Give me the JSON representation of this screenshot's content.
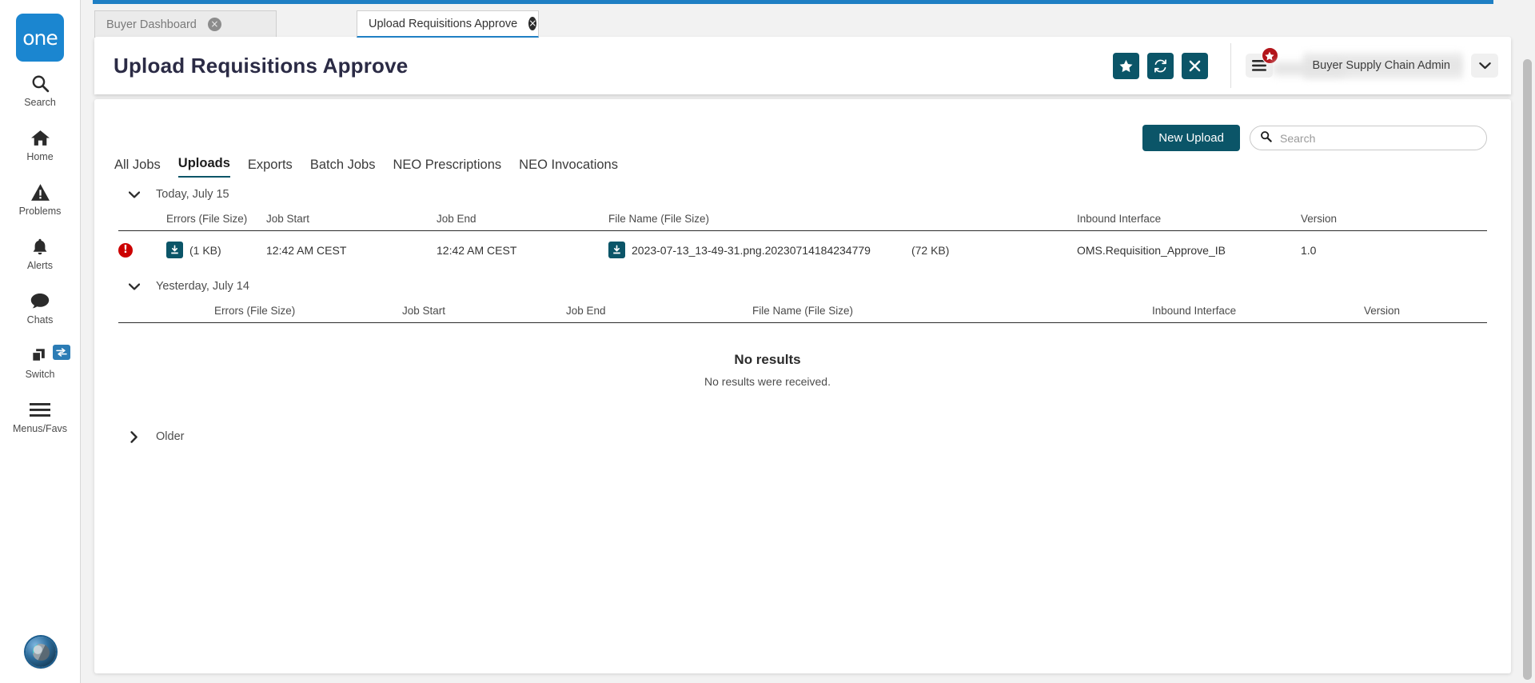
{
  "brand": {
    "logo_text": "one",
    "logo_color": "#1b86d0"
  },
  "theme": {
    "accent_teal": "#0b5568",
    "tab_blue": "#1f7fc4",
    "error_red": "#cc0000",
    "badge_red": "#b3151b"
  },
  "sidebar": {
    "items": [
      {
        "label": "Search",
        "icon": "search-icon"
      },
      {
        "label": "Home",
        "icon": "home-icon"
      },
      {
        "label": "Problems",
        "icon": "warning-triangle-icon"
      },
      {
        "label": "Alerts",
        "icon": "bell-icon"
      },
      {
        "label": "Chats",
        "icon": "chat-bubble-icon"
      },
      {
        "label": "Switch",
        "icon": "switch-windows-icon"
      },
      {
        "label": "Menus/Favs",
        "icon": "hamburger-icon"
      }
    ]
  },
  "browser_tabs": [
    {
      "label": "Buyer Dashboard",
      "active": false,
      "close": "×"
    },
    {
      "label": "Upload Requisitions Approve",
      "active": true,
      "close": "×"
    }
  ],
  "header": {
    "title": "Upload Requisitions Approve",
    "buttons": [
      {
        "name": "favorite-button",
        "icon": "star-icon"
      },
      {
        "name": "refresh-button",
        "icon": "refresh-icon"
      },
      {
        "name": "close-button",
        "icon": "close-x-icon"
      }
    ],
    "menu_icon": "hamburger-icon",
    "menu_badge_icon": "star-icon",
    "user_role": "Buyer Supply Chain Admin",
    "caret_icon": "chevron-down-icon"
  },
  "toolbar": {
    "new_upload_label": "New Upload",
    "search_placeholder": "Search",
    "search_value": "",
    "search_icon": "search-icon"
  },
  "job_tabs": [
    {
      "label": "All Jobs",
      "active": false
    },
    {
      "label": "Uploads",
      "active": true
    },
    {
      "label": "Exports",
      "active": false
    },
    {
      "label": "Batch Jobs",
      "active": false
    },
    {
      "label": "NEO Prescriptions",
      "active": false
    },
    {
      "label": "NEO Invocations",
      "active": false
    }
  ],
  "columns": [
    "Errors (File Size)",
    "Job Start",
    "Job End",
    "File Name (File Size)",
    "Inbound Interface",
    "Version"
  ],
  "groups": {
    "today": {
      "title": "Today, July 15",
      "expanded": true,
      "chevron": "chevron-down-icon",
      "rows": [
        {
          "status_icon": "error-exclamation-icon",
          "errors_download_icon": "download-icon",
          "errors_size": "(1 KB)",
          "job_start": "12:42 AM CEST",
          "job_end": "12:42 AM CEST",
          "file_download_icon": "download-icon",
          "file_name": "2023-07-13_13-49-31.png.20230714184234779",
          "file_size": "(72 KB)",
          "inbound_interface": "OMS.Requisition_Approve_IB",
          "version": "1.0"
        }
      ]
    },
    "yesterday": {
      "title": "Yesterday, July 14",
      "expanded": true,
      "chevron": "chevron-down-icon",
      "empty_title": "No results",
      "empty_subtitle": "No results were received."
    },
    "older": {
      "title": "Older",
      "expanded": false,
      "chevron": "chevron-right-icon"
    }
  }
}
